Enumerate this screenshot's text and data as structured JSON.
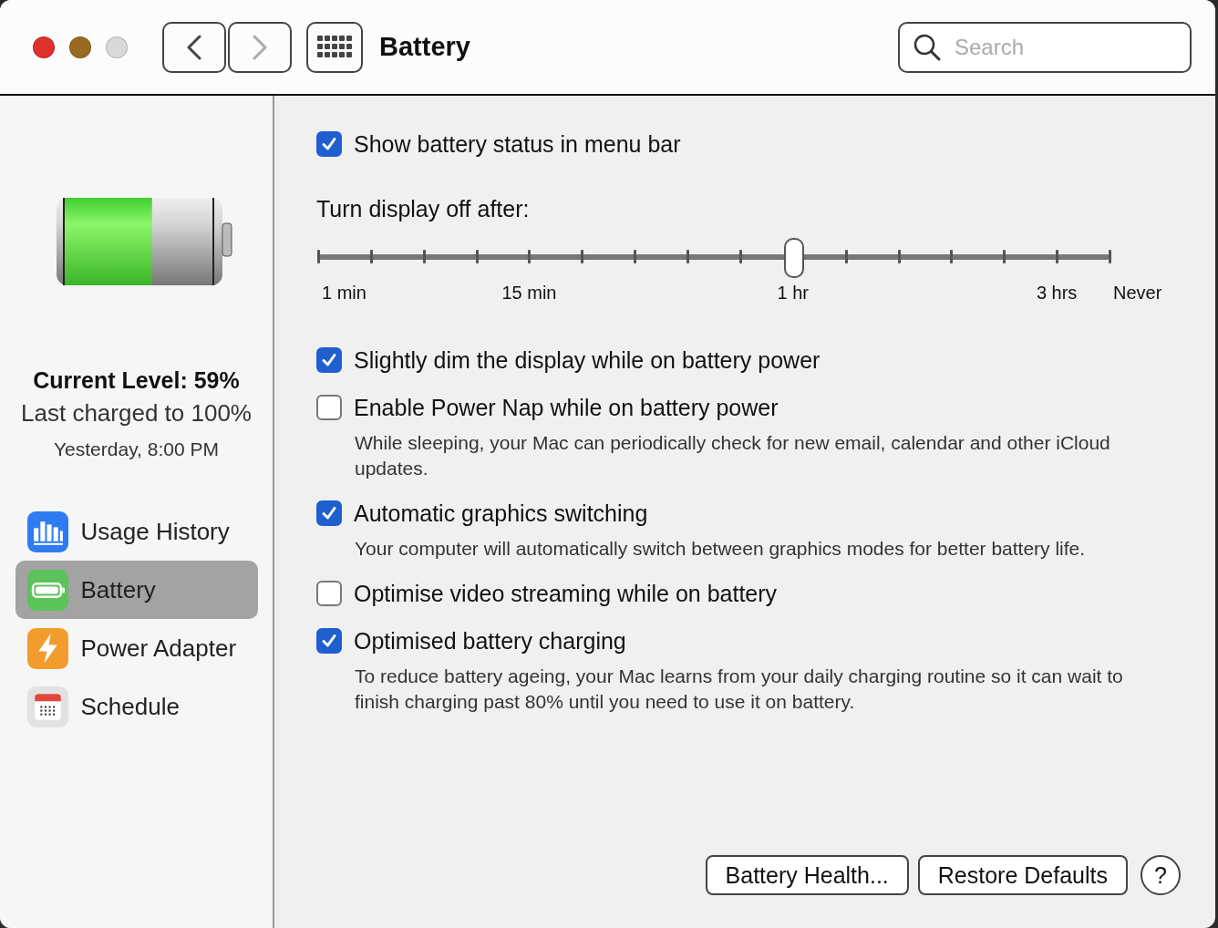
{
  "window": {
    "title": "Battery",
    "controls": [
      {
        "color": "#e0302a"
      },
      {
        "color": "#9a6a22"
      },
      {
        "color": "#d9d9d9"
      }
    ],
    "back": {
      "disabled": false
    },
    "forward": {
      "disabled": true
    }
  },
  "search": {
    "placeholder": "Search"
  },
  "sidebar": {
    "battery": {
      "level": 0.59
    },
    "current_level": "Current Level: 59%",
    "last_charged": "Last charged to 100%",
    "last_charged_time": "Yesterday, 8:00 PM",
    "items": [
      {
        "label": "Usage History",
        "kind": "chart",
        "selected": false
      },
      {
        "label": "Battery",
        "kind": "battery",
        "selected": true
      },
      {
        "label": "Power Adapter",
        "kind": "bolt",
        "selected": false
      },
      {
        "label": "Schedule",
        "kind": "calendar",
        "selected": false
      }
    ]
  },
  "settings": [
    {
      "kind": "checkbox",
      "label": "Show battery status in menu bar",
      "checked": true
    },
    {
      "kind": "slider",
      "label": "Turn display off after:",
      "level": 0.6,
      "stops": [
        {
          "kind": "labeled",
          "label": "1 min"
        },
        {
          "kind": "tick"
        },
        {
          "kind": "tick"
        },
        {
          "kind": "tick"
        },
        {
          "kind": "labeled",
          "label": "15 min"
        },
        {
          "kind": "tick"
        },
        {
          "kind": "tick"
        },
        {
          "kind": "tick"
        },
        {
          "kind": "tick"
        },
        {
          "kind": "labeled",
          "label": "1 hr"
        },
        {
          "kind": "tick"
        },
        {
          "kind": "tick"
        },
        {
          "kind": "tick"
        },
        {
          "kind": "tick"
        },
        {
          "kind": "labeled",
          "label": "3 hrs"
        },
        {
          "kind": "labeled",
          "label": "Never"
        }
      ]
    },
    {
      "kind": "checkbox",
      "label": "Slightly dim the display while on battery power",
      "checked": true
    },
    {
      "kind": "checkbox",
      "label": "Enable Power Nap while on battery power",
      "checked": false,
      "description": "While sleeping, your Mac can periodically check for new email, calendar and other iCloud updates."
    },
    {
      "kind": "checkbox",
      "label": "Automatic graphics switching",
      "checked": true,
      "description": "Your computer will automatically switch between graphics modes for better battery life."
    },
    {
      "kind": "checkbox",
      "label": "Optimise video streaming while on battery",
      "checked": false
    },
    {
      "kind": "checkbox",
      "label": "Optimised battery charging",
      "checked": true,
      "description": "To reduce battery ageing, your Mac learns from your daily charging routine so it can wait to finish charging past 80% until you need to use it on battery."
    }
  ],
  "buttons": [
    {
      "label": "Battery Health..."
    },
    {
      "label": "Restore Defaults"
    },
    {
      "label": "?"
    }
  ]
}
